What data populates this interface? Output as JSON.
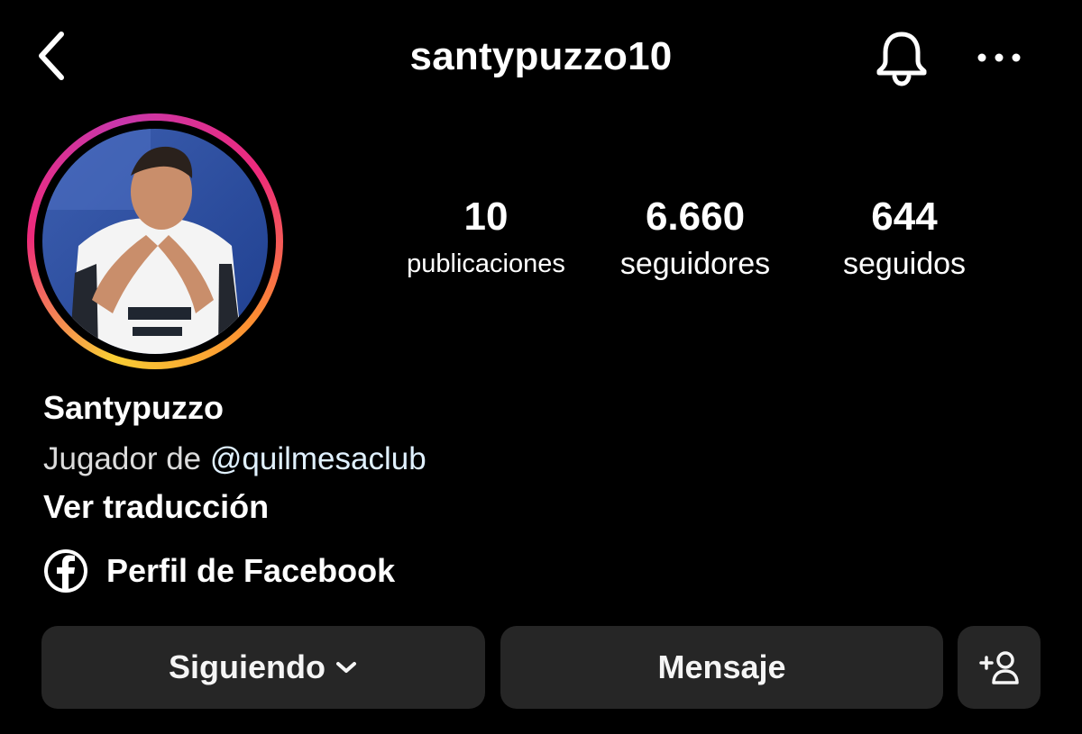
{
  "header": {
    "username": "santypuzzo10"
  },
  "icons": {
    "back": "chevron-left-icon",
    "notifications": "bell-icon",
    "more": "more-horizontal-icon",
    "facebook": "facebook-icon",
    "dropdown": "chevron-down-icon",
    "add_user": "add-user-icon"
  },
  "colors": {
    "background": "#000000",
    "button_bg": "#262626",
    "link": "#e0f1ff",
    "story_ring": [
      "#f9ce34",
      "#ee2a7b",
      "#c837ab"
    ]
  },
  "stats": {
    "posts": {
      "value": "10",
      "label": "publicaciones"
    },
    "followers": {
      "value": "6.660",
      "label": "seguidores"
    },
    "following": {
      "value": "644",
      "label": "seguidos"
    }
  },
  "profile": {
    "name": "Santypuzzo",
    "bio_prefix": "Jugador de ",
    "bio_mention": "@quilmesaclub",
    "translate": "Ver traducción",
    "facebook_link": "Perfil de Facebook"
  },
  "actions": {
    "following": "Siguiendo",
    "message": "Mensaje"
  }
}
